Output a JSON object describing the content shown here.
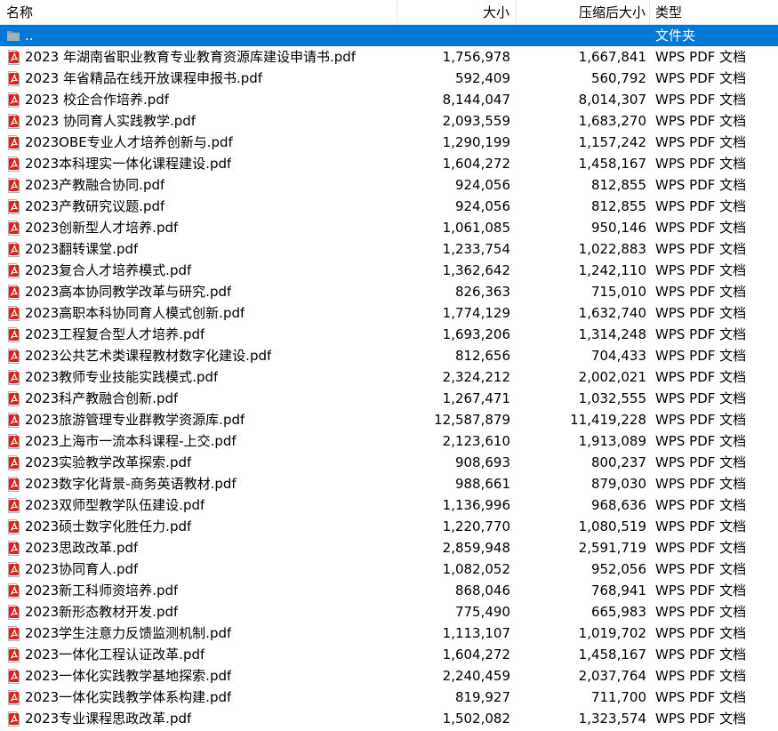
{
  "columns": {
    "name": "名称",
    "size": "大小",
    "packed": "压缩后大小",
    "type": "类型"
  },
  "sort_indicator": "^",
  "parent": {
    "name": "..",
    "type": "文件夹"
  },
  "files": [
    {
      "name": "2023 年湖南省职业教育专业教育资源库建设申请书.pdf",
      "size": "1,756,978",
      "packed": "1,667,841",
      "type": "WPS PDF 文档"
    },
    {
      "name": "2023 年省精品在线开放课程申报书.pdf",
      "size": "592,409",
      "packed": "560,792",
      "type": "WPS PDF 文档"
    },
    {
      "name": "2023 校企合作培养.pdf",
      "size": "8,144,047",
      "packed": "8,014,307",
      "type": "WPS PDF 文档"
    },
    {
      "name": "2023 协同育人实践教学.pdf",
      "size": "2,093,559",
      "packed": "1,683,270",
      "type": "WPS PDF 文档"
    },
    {
      "name": "2023OBE专业人才培养创新与.pdf",
      "size": "1,290,199",
      "packed": "1,157,242",
      "type": "WPS PDF 文档"
    },
    {
      "name": "2023本科理实一体化课程建设.pdf",
      "size": "1,604,272",
      "packed": "1,458,167",
      "type": "WPS PDF 文档"
    },
    {
      "name": "2023产教融合协同.pdf",
      "size": "924,056",
      "packed": "812,855",
      "type": "WPS PDF 文档"
    },
    {
      "name": "2023产教研究议题.pdf",
      "size": "924,056",
      "packed": "812,855",
      "type": "WPS PDF 文档"
    },
    {
      "name": "2023创新型人才培养.pdf",
      "size": "1,061,085",
      "packed": "950,146",
      "type": "WPS PDF 文档"
    },
    {
      "name": "2023翻转课堂.pdf",
      "size": "1,233,754",
      "packed": "1,022,883",
      "type": "WPS PDF 文档"
    },
    {
      "name": "2023复合人才培养模式.pdf",
      "size": "1,362,642",
      "packed": "1,242,110",
      "type": "WPS PDF 文档"
    },
    {
      "name": "2023高本协同教学改革与研究.pdf",
      "size": "826,363",
      "packed": "715,010",
      "type": "WPS PDF 文档"
    },
    {
      "name": "2023高职本科协同育人模式创新.pdf",
      "size": "1,774,129",
      "packed": "1,632,740",
      "type": "WPS PDF 文档"
    },
    {
      "name": "2023工程复合型人才培养.pdf",
      "size": "1,693,206",
      "packed": "1,314,248",
      "type": "WPS PDF 文档"
    },
    {
      "name": "2023公共艺术类课程教材数字化建设.pdf",
      "size": "812,656",
      "packed": "704,433",
      "type": "WPS PDF 文档"
    },
    {
      "name": "2023教师专业技能实践模式.pdf",
      "size": "2,324,212",
      "packed": "2,002,021",
      "type": "WPS PDF 文档"
    },
    {
      "name": "2023科产教融合创新.pdf",
      "size": "1,267,471",
      "packed": "1,032,555",
      "type": "WPS PDF 文档"
    },
    {
      "name": "2023旅游管理专业群教学资源库.pdf",
      "size": "12,587,879",
      "packed": "11,419,228",
      "type": "WPS PDF 文档"
    },
    {
      "name": "2023上海市一流本科课程-上交.pdf",
      "size": "2,123,610",
      "packed": "1,913,089",
      "type": "WPS PDF 文档"
    },
    {
      "name": "2023实验教学改革探索.pdf",
      "size": "908,693",
      "packed": "800,237",
      "type": "WPS PDF 文档"
    },
    {
      "name": "2023数字化背景-商务英语教材.pdf",
      "size": "988,661",
      "packed": "879,030",
      "type": "WPS PDF 文档"
    },
    {
      "name": "2023双师型教学队伍建设.pdf",
      "size": "1,136,996",
      "packed": "968,636",
      "type": "WPS PDF 文档"
    },
    {
      "name": "2023硕士数字化胜任力.pdf",
      "size": "1,220,770",
      "packed": "1,080,519",
      "type": "WPS PDF 文档"
    },
    {
      "name": "2023思政改革.pdf",
      "size": "2,859,948",
      "packed": "2,591,719",
      "type": "WPS PDF 文档"
    },
    {
      "name": "2023协同育人.pdf",
      "size": "1,082,052",
      "packed": "952,056",
      "type": "WPS PDF 文档"
    },
    {
      "name": "2023新工科师资培养.pdf",
      "size": "868,046",
      "packed": "768,941",
      "type": "WPS PDF 文档"
    },
    {
      "name": "2023新形态教材开发.pdf",
      "size": "775,490",
      "packed": "665,983",
      "type": "WPS PDF 文档"
    },
    {
      "name": "2023学生注意力反馈监测机制.pdf",
      "size": "1,113,107",
      "packed": "1,019,702",
      "type": "WPS PDF 文档"
    },
    {
      "name": "2023一体化工程认证改革.pdf",
      "size": "1,604,272",
      "packed": "1,458,167",
      "type": "WPS PDF 文档"
    },
    {
      "name": "2023一体化实践教学基地探索.pdf",
      "size": "2,240,459",
      "packed": "2,037,764",
      "type": "WPS PDF 文档"
    },
    {
      "name": "2023一体化实践教学体系构建.pdf",
      "size": "819,927",
      "packed": "711,700",
      "type": "WPS PDF 文档"
    },
    {
      "name": "2023专业课程思政改革.pdf",
      "size": "1,502,082",
      "packed": "1,323,574",
      "type": "WPS PDF 文档"
    }
  ],
  "colors": {
    "selection": "#0078d7",
    "pdf_icon": "#e02020",
    "folder_icon": "#8a9aa6"
  },
  "icons": {
    "folder": "folder-up-icon",
    "file": "pdf-file-icon"
  }
}
